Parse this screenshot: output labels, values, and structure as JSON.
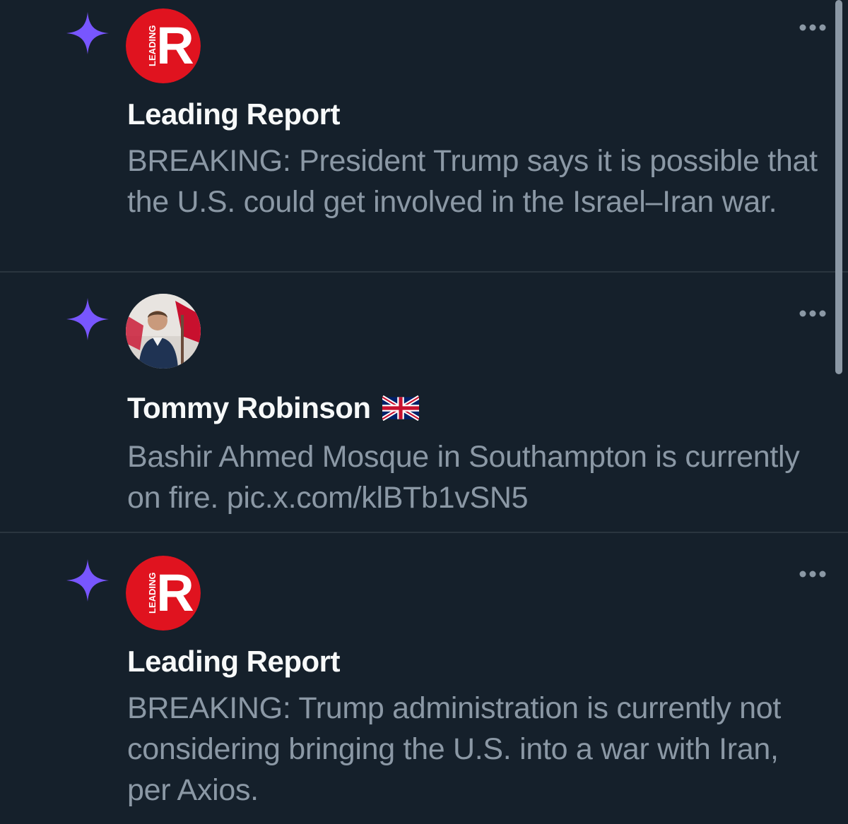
{
  "notifications": [
    {
      "name": "Leading Report",
      "text": "BREAKING: President Trump says it is possible that the U.S. could get involved in the Israel–Iran war.",
      "avatar": "leading-report-logo",
      "logo_text": "LEADING",
      "logo_letter": "R",
      "icon": "sparkle-icon"
    },
    {
      "name": "Tommy Robinson",
      "name_suffix_icon": "uk-flag-icon",
      "text": "Bashir Ahmed Mosque in Southampton is currently on fire. pic.x.com/klBTb1vSN5",
      "avatar": "profile-photo",
      "icon": "sparkle-icon"
    },
    {
      "name": "Leading Report",
      "text": "BREAKING: Trump administration is currently not considering bringing the U.S. into a war with Iran, per Axios.",
      "avatar": "leading-report-logo",
      "logo_text": "LEADING",
      "logo_letter": "R",
      "icon": "sparkle-icon"
    }
  ],
  "colors": {
    "background": "#15202b",
    "name": "#f7f9f9",
    "text": "#8b98a5",
    "sparkle": "#7856ff",
    "logo_red": "#e0131f",
    "divider": "#2a353f"
  }
}
